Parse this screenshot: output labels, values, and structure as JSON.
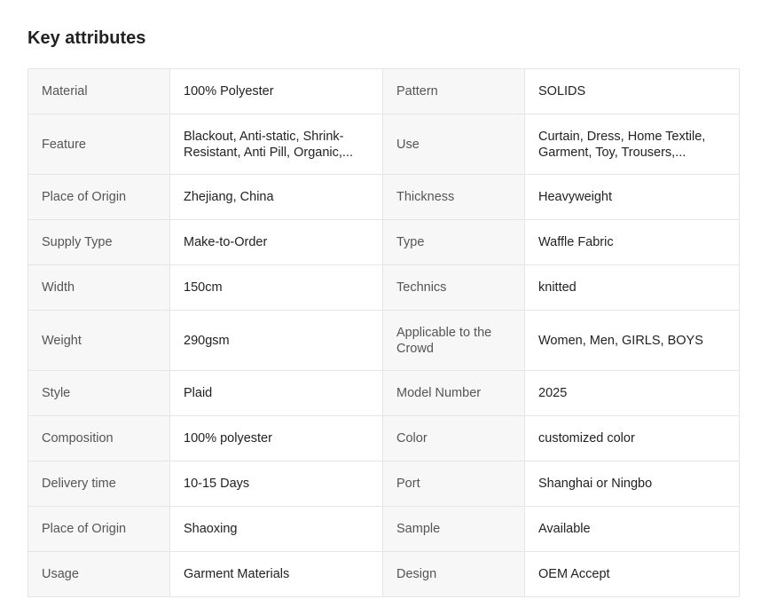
{
  "section": {
    "title": "Key attributes"
  },
  "rows": [
    {
      "k1": "Material",
      "v1": "100% Polyester",
      "k2": "Pattern",
      "v2": "SOLIDS"
    },
    {
      "k1": "Feature",
      "v1": "Blackout, Anti-static, Shrink-Resistant, Anti Pill, Organic,...",
      "k2": "Use",
      "v2": "Curtain, Dress, Home Textile, Garment, Toy, Trousers,..."
    },
    {
      "k1": "Place of Origin",
      "v1": "Zhejiang, China",
      "k2": "Thickness",
      "v2": "Heavyweight"
    },
    {
      "k1": "Supply Type",
      "v1": "Make-to-Order",
      "k2": "Type",
      "v2": "Waffle Fabric"
    },
    {
      "k1": "Width",
      "v1": "150cm",
      "k2": "Technics",
      "v2": "knitted"
    },
    {
      "k1": "Weight",
      "v1": "290gsm",
      "k2": "Applicable to the Crowd",
      "v2": "Women, Men, GIRLS, BOYS"
    },
    {
      "k1": "Style",
      "v1": "Plaid",
      "k2": "Model Number",
      "v2": "2025"
    },
    {
      "k1": "Composition",
      "v1": "100% polyester",
      "k2": "Color",
      "v2": "customized color"
    },
    {
      "k1": "Delivery time",
      "v1": "10-15 Days",
      "k2": "Port",
      "v2": "Shanghai or Ningbo"
    },
    {
      "k1": "Place of Origin",
      "v1": "Shaoxing",
      "k2": "Sample",
      "v2": "Available"
    },
    {
      "k1": "Usage",
      "v1": "Garment Materials",
      "k2": "Design",
      "v2": "OEM Accept"
    }
  ]
}
